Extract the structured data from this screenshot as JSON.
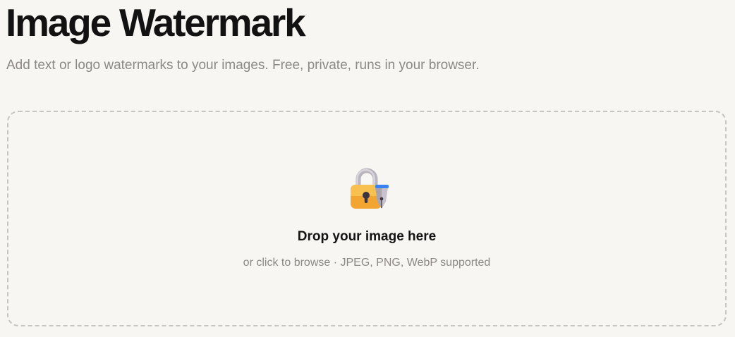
{
  "header": {
    "title": "Image Watermark",
    "subtitle": "Add text or logo watermarks to your images. Free, private, runs in your browser."
  },
  "dropzone": {
    "icon": "locked-with-pen-icon",
    "title": "Drop your image here",
    "hint": "or click to browse · JPEG, PNG, WebP supported"
  },
  "colors": {
    "background": "#f8f6f3",
    "title_text": "#121212",
    "muted_text": "#8c8883",
    "dropzone_border": "#c8c4bf",
    "lock_body": "#f6b33c",
    "lock_shackle": "#b9b4bd",
    "pen_accent": "#3b82f6"
  }
}
